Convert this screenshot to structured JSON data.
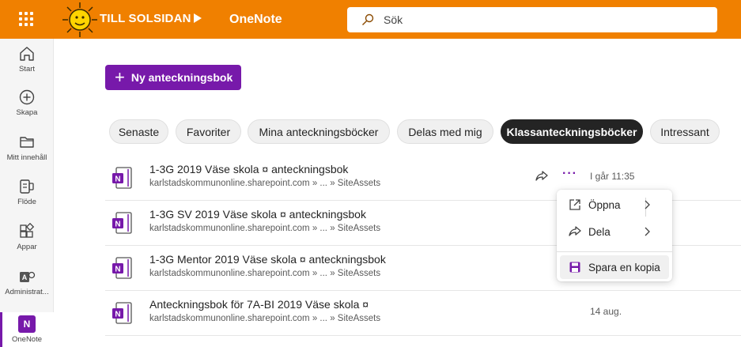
{
  "header": {
    "brand": "TILL SOLSIDAN",
    "app_name": "OneNote",
    "search": {
      "placeholder": "Sök",
      "value": ""
    },
    "colors": {
      "bar": "#f08000",
      "accent": "#7719aa"
    }
  },
  "rail": {
    "items": [
      {
        "label": "Start",
        "icon": "home-icon"
      },
      {
        "label": "Skapa",
        "icon": "add-circle-icon"
      },
      {
        "label": "Mitt innehåll",
        "icon": "folder-icon"
      },
      {
        "label": "Flöde",
        "icon": "feed-icon"
      },
      {
        "label": "Appar",
        "icon": "apps-icon"
      },
      {
        "label": "Administrat...",
        "icon": "admin-icon"
      },
      {
        "label": "OneNote",
        "icon": "onenote-icon",
        "active": true
      }
    ]
  },
  "main": {
    "new_button": "Ny anteckningsbok",
    "filters": [
      {
        "label": "Senaste"
      },
      {
        "label": "Favoriter"
      },
      {
        "label": "Mina anteckningsböcker"
      },
      {
        "label": "Delas med mig"
      },
      {
        "label": "Klassanteckningsböcker",
        "active": true
      },
      {
        "label": "Intressant"
      }
    ],
    "notebooks": [
      {
        "title": "1-3G 2019 Väse skola ¤ anteckningsbok",
        "path": "karlstadskommunonline.sharepoint.com » ... » SiteAssets",
        "date": "I går 11:35"
      },
      {
        "title": "1-3G SV 2019 Väse skola ¤ anteckningsbok",
        "path": "karlstadskommunonline.sharepoint.com » ... » SiteAssets",
        "date": ""
      },
      {
        "title": "1-3G Mentor 2019 Väse skola ¤ anteckningsbok",
        "path": "karlstadskommunonline.sharepoint.com » ... » SiteAssets",
        "date": ""
      },
      {
        "title": "Anteckningsbok för 7A-BI 2019 Väse skola ¤",
        "path": "karlstadskommunonline.sharepoint.com » ... » SiteAssets",
        "date": "14 aug."
      }
    ],
    "notebook_icon_letter": "N",
    "more_glyph": "···"
  },
  "context_menu": {
    "items": [
      {
        "label": "Öppna",
        "icon": "open-external-icon"
      },
      {
        "label": "Dela",
        "icon": "share-icon"
      },
      {
        "label": "Spara en kopia",
        "icon": "save-icon"
      }
    ]
  }
}
